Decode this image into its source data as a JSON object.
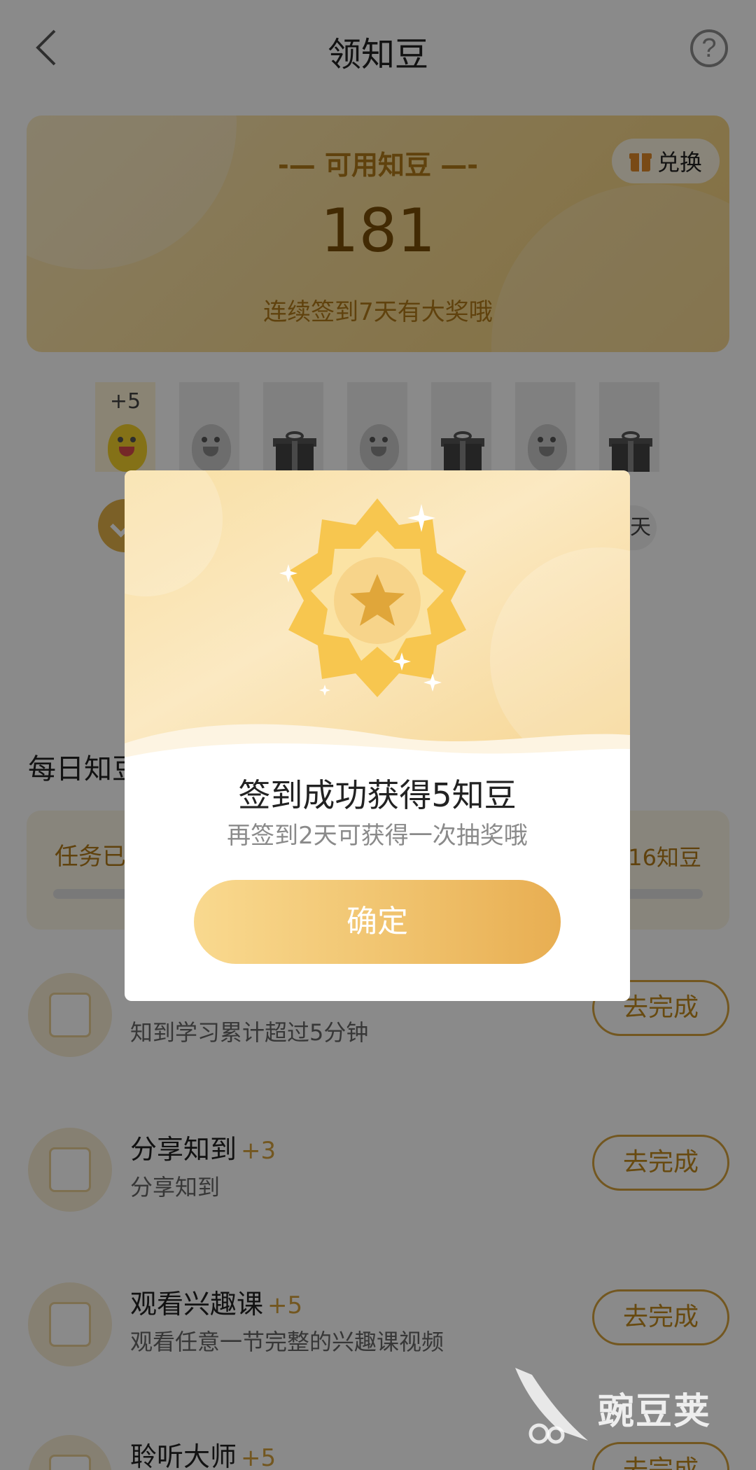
{
  "header": {
    "title": "领知豆",
    "help_symbol": "?"
  },
  "balance": {
    "label": "-— 可用知豆 —-",
    "value": "181",
    "tip": "连续签到7天有大奖哦",
    "exchange_label": "兑换"
  },
  "days": {
    "first_bonus": "+5",
    "day7_suffix": "天",
    "cells": [
      "bean-gold",
      "bean",
      "gift",
      "bean",
      "gift",
      "bean",
      "gift"
    ]
  },
  "daily": {
    "title_visible": "每日知豆",
    "progress_label": "任务已",
    "progress_total": "16知豆"
  },
  "tasks": [
    {
      "name": "",
      "points": "",
      "desc": "知到学习累计超过5分钟",
      "button": "去完成"
    },
    {
      "name": "分享知到",
      "points": "+3",
      "desc": "分享知到",
      "button": "去完成"
    },
    {
      "name": "观看兴趣课",
      "points": "+5",
      "desc": "观看任意一节完整的兴趣课视频",
      "button": "去完成"
    },
    {
      "name": "聆听大师",
      "points": "+5",
      "desc": "",
      "button": "去完成"
    }
  ],
  "modal": {
    "title": "签到成功获得5知豆",
    "subtitle": "再签到2天可获得一次抽奖哦",
    "confirm": "确定"
  },
  "watermark": {
    "text": "豌豆荚"
  },
  "colors": {
    "accent": "#d4a23b",
    "brand_dark": "#7a4f07",
    "overlay": "rgba(0,0,0,0.46)"
  }
}
